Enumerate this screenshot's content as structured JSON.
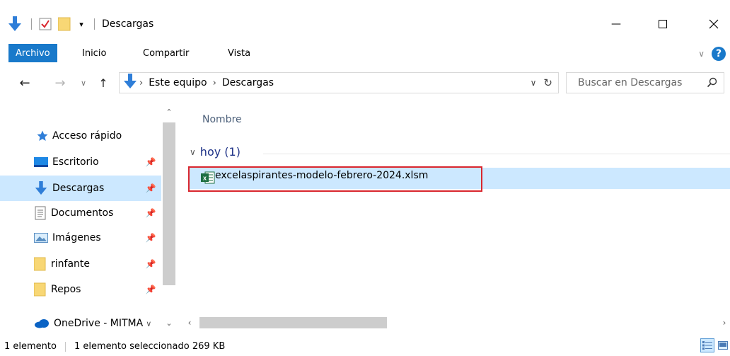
{
  "window": {
    "title": "Descargas",
    "minimize_glyph": "—",
    "maximize_glyph": "☐",
    "close_glyph": "✕"
  },
  "ribbon": {
    "tabs": [
      "Archivo",
      "Inicio",
      "Compartir",
      "Vista"
    ],
    "help_glyph": "?"
  },
  "address": {
    "crumbs": [
      "Este equipo",
      "Descargas"
    ],
    "search_placeholder": "Buscar en Descargas"
  },
  "nav": {
    "quick_access": "Acceso rápido",
    "items": [
      {
        "label": "Escritorio",
        "icon": "desktop-icon"
      },
      {
        "label": "Descargas",
        "icon": "downloads-icon"
      },
      {
        "label": "Documentos",
        "icon": "documents-icon"
      },
      {
        "label": "Imágenes",
        "icon": "pictures-icon"
      },
      {
        "label": "rinfante",
        "icon": "folder-icon"
      },
      {
        "label": "Repos",
        "icon": "folder-icon"
      }
    ],
    "onedrive": "OneDrive - MITMA"
  },
  "content": {
    "column_name": "Nombre",
    "group_label": "hoy (1)",
    "files": [
      {
        "name": "excelaspirantes-modelo-febrero-2024.xlsm",
        "icon": "excel-icon",
        "selected": true
      }
    ]
  },
  "status": {
    "count": "1 elemento",
    "selection": "1 elemento seleccionado  269 KB"
  },
  "colors": {
    "accent": "#1979ca",
    "selection": "#cce8ff",
    "highlight_border": "#d9262e"
  }
}
